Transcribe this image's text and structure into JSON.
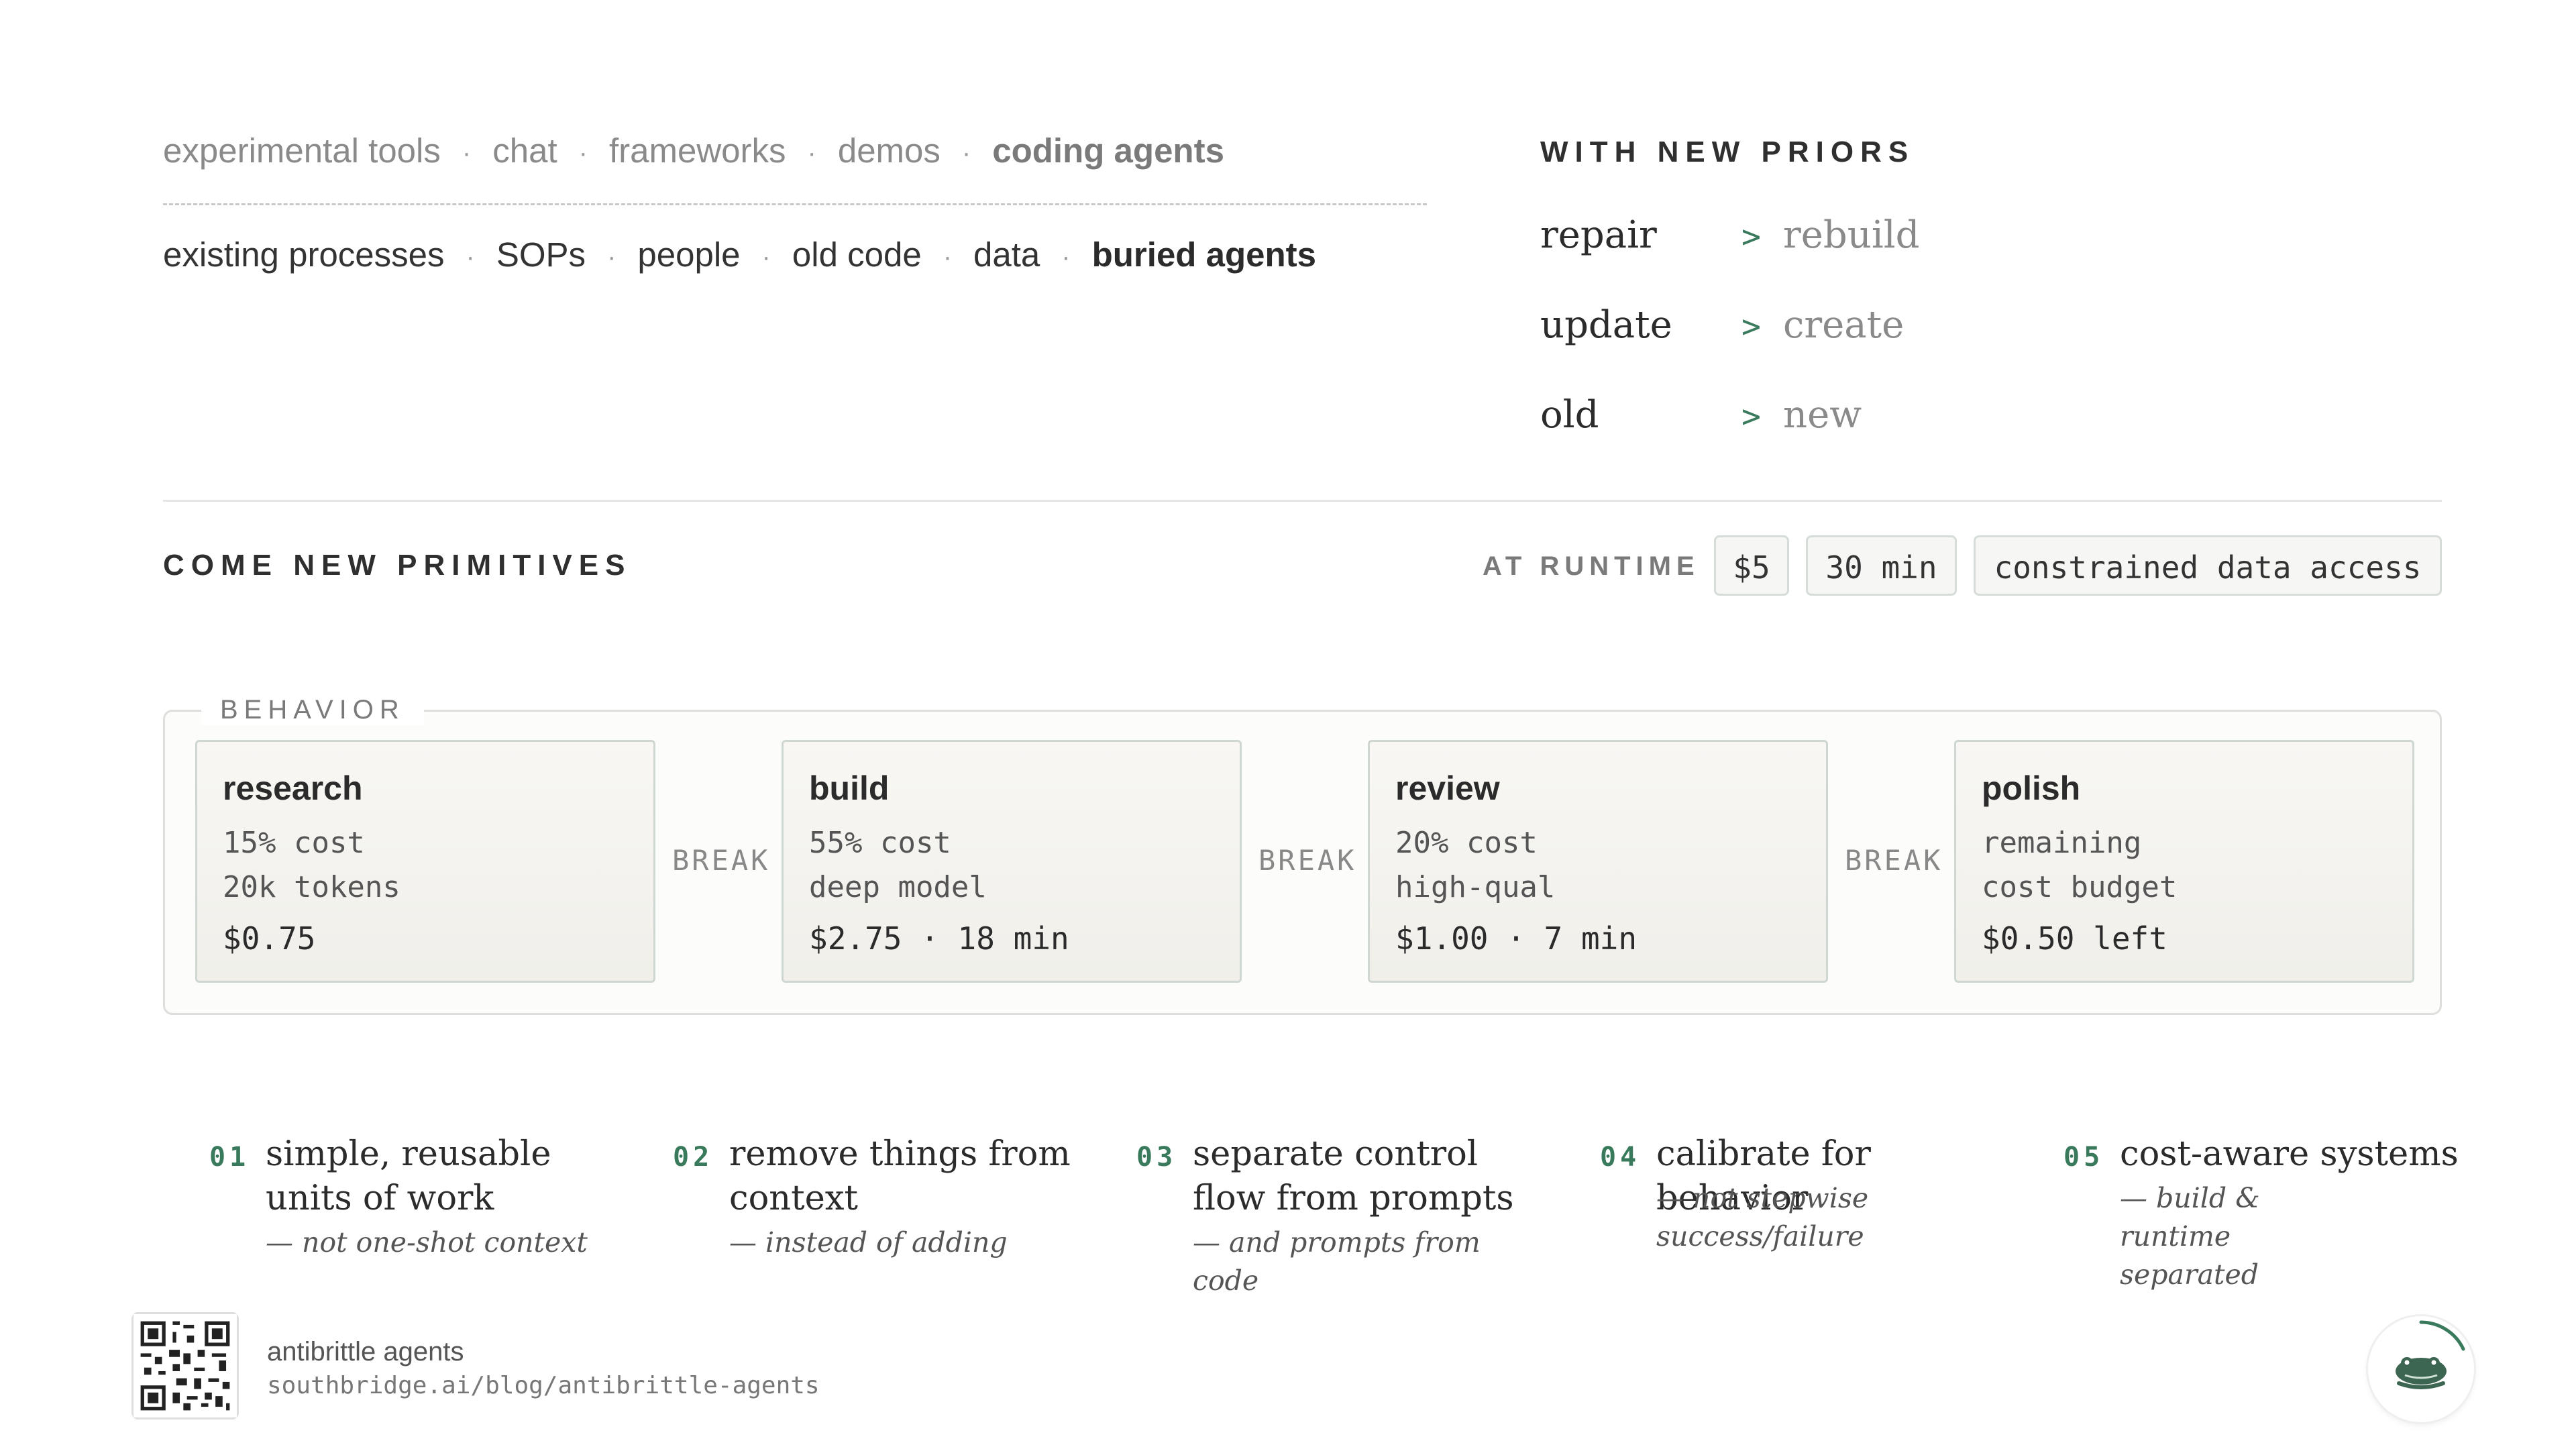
{
  "top_categories": {
    "row1": [
      "experimental tools",
      "chat",
      "frameworks",
      "demos",
      "coding agents"
    ],
    "row2": [
      "existing processes",
      "SOPs",
      "people",
      "old code",
      "data",
      "buried agents"
    ],
    "separator": "·"
  },
  "priors": {
    "heading": "WITH NEW PRIORS",
    "arrow": ">",
    "items": [
      {
        "old": "repair",
        "new": "rebuild"
      },
      {
        "old": "update",
        "new": "create"
      },
      {
        "old": "old",
        "new": "new"
      }
    ]
  },
  "primitives": {
    "heading": "COME NEW PRIMITIVES",
    "runtime_label": "AT RUNTIME",
    "chips": [
      "$5",
      "30 min",
      "constrained data access"
    ]
  },
  "behavior": {
    "legend": "BEHAVIOR",
    "break_label": "BREAK",
    "stages": [
      {
        "title": "research",
        "line1": "15% cost",
        "line2": "20k tokens",
        "price": "$0.75"
      },
      {
        "title": "build",
        "line1": "55% cost",
        "line2": "deep model",
        "price": "$2.75 · 18 min"
      },
      {
        "title": "review",
        "line1": "20% cost",
        "line2": "high-qual",
        "price": "$1.00 · 7 min"
      },
      {
        "title": "polish",
        "line1": "remaining",
        "line2": "cost budget",
        "price": "$0.50 left"
      }
    ]
  },
  "principles": [
    {
      "num": "01",
      "title": "simple, reusable units of work",
      "sub": "— not one-shot context"
    },
    {
      "num": "02",
      "title": "remove things from context",
      "sub": "— instead of adding"
    },
    {
      "num": "03",
      "title": "separate control flow from prompts",
      "sub": "— and prompts from code"
    },
    {
      "num": "04",
      "title": "calibrate for behavior",
      "sub": "— not stepwise success/failure"
    },
    {
      "num": "05",
      "title": "cost-aware systems",
      "sub": "— build & runtime separated"
    }
  ],
  "footer": {
    "title": "antibrittle agents",
    "url": "southbridge.ai/blog/antibrittle-agents",
    "qr_icon": "qr-code-icon",
    "logo_icon": "frog-logo-icon"
  },
  "colors": {
    "accent": "#3a7a5c",
    "muted": "#8a8a8a",
    "text": "#2b2b2b"
  }
}
